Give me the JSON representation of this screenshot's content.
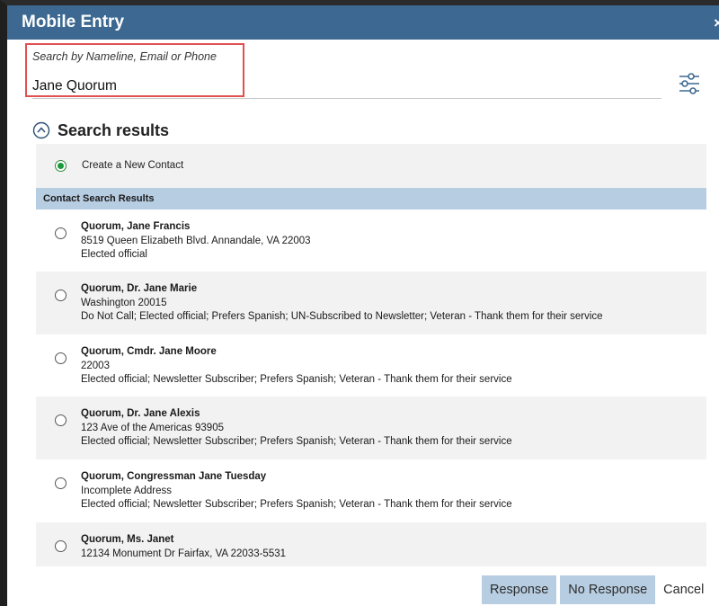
{
  "window": {
    "title": "Mobile Entry",
    "close_glyph": "×"
  },
  "search": {
    "label": "Search by Nameline, Email or Phone",
    "value": "Jane Quorum"
  },
  "results": {
    "title": "Search results",
    "new_contact_label": "Create a New Contact",
    "new_contact_selected": true,
    "section_header": "Contact Search Results",
    "contacts": [
      {
        "name": "Quorum, Jane Francis",
        "address": "8519 Queen Elizabeth Blvd. Annandale, VA 22003",
        "tags": "Elected official"
      },
      {
        "name": "Quorum, Dr. Jane Marie",
        "address": "Washington 20015",
        "tags": "Do Not Call; Elected official; Prefers Spanish; UN-Subscribed to Newsletter; Veteran - Thank them for their service"
      },
      {
        "name": "Quorum, Cmdr. Jane Moore",
        "address": "22003",
        "tags": "Elected official; Newsletter Subscriber; Prefers Spanish; Veteran - Thank them for their service"
      },
      {
        "name": "Quorum, Dr. Jane Alexis",
        "address": "123 Ave of the Americas 93905",
        "tags": "Elected official; Newsletter Subscriber; Prefers Spanish; Veteran - Thank them for their service"
      },
      {
        "name": "Quorum, Congressman Jane Tuesday",
        "address": "Incomplete Address",
        "tags": "Elected official; Newsletter Subscriber; Prefers Spanish; Veteran - Thank them for their service"
      },
      {
        "name": "Quorum, Ms. Janet",
        "address": "12134 Monument Dr Fairfax, VA 22033-5531",
        "tags": ""
      }
    ]
  },
  "footer": {
    "response_label": "Response",
    "no_response_label": "No Response",
    "cancel_label": "Cancel"
  },
  "icons": {
    "filter": "sliders-icon",
    "collapse": "chevron-up-circle-icon"
  },
  "colors": {
    "titlebar": "#3c6891",
    "section_header": "#b7cde1",
    "highlight_border": "#e05050",
    "radio_selected": "#1a9a3a"
  }
}
